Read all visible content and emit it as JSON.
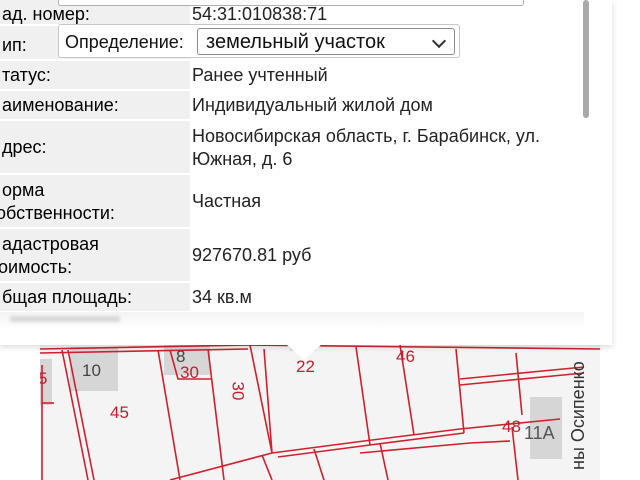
{
  "popup": {
    "top_row": {
      "label": "ад. номер:",
      "value": "54:31:010838:71"
    },
    "definition": {
      "row_label": "ип:",
      "label": "Определение:",
      "selected": "земельный участок"
    },
    "rows": [
      {
        "label_lines": [
          "татус:"
        ],
        "value_lines": [
          "Ранее учтенный"
        ]
      },
      {
        "label_lines": [
          "аименование:"
        ],
        "value_lines": [
          "Индивидуальный жилой дом"
        ]
      },
      {
        "label_lines": [
          "дрес:"
        ],
        "value_lines": [
          "Новосибирская область, г. Барабинск, ул.",
          "Южная, д. 6"
        ]
      },
      {
        "label_lines": [
          "орма",
          "обственности:"
        ],
        "value_lines": [
          "Частная"
        ]
      },
      {
        "label_lines": [
          "адастровая",
          "оимость:"
        ],
        "value_lines": [
          "927670.81 руб"
        ]
      },
      {
        "label_lines": [
          "бщая площадь:"
        ],
        "value_lines": [
          "34 кв.м"
        ]
      }
    ]
  },
  "map": {
    "street_name": "ны Осипенко",
    "parcel_labels": [
      "10",
      "8",
      "30",
      "30",
      "22",
      "46",
      "45",
      "48",
      "11А",
      "5"
    ],
    "colors": {
      "parcel_line": "#d0202e",
      "building": "#d8d8d8",
      "background": "#f4f4f4"
    }
  }
}
